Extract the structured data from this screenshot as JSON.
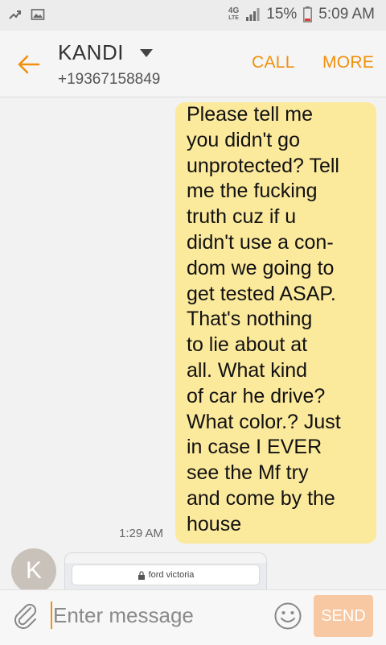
{
  "status_bar": {
    "network_label": "4G",
    "network_sub": "LTE",
    "battery": "15%",
    "time": "5:09 AM"
  },
  "header": {
    "contact_name": "KANDI",
    "contact_number": "+19367158849",
    "call_label": "CALL",
    "more_label": "MORE"
  },
  "conversation": {
    "message_text": "Please tell me\nyou didn't go\nunprotected? Tell\nme the fucking\ntruth cuz if u\ndidn't use a con-\ndom we going to\nget tested ASAP.\nThat's nothing\nto lie about at\nall. What kind\nof car he drive?\nWhat color.? Just\nin case I EVER\nsee the Mf try\nand come by the\nhouse",
    "message_time": "1:29 AM",
    "avatar_letter": "K",
    "attachment_url_text": "ford victoria"
  },
  "input_bar": {
    "placeholder": "Enter message",
    "send_label": "SEND"
  },
  "colors": {
    "accent": "#f0900c",
    "bubble": "#fbe99c",
    "avatar": "#c9c2ba",
    "send_disabled": "#f7c8a2"
  }
}
